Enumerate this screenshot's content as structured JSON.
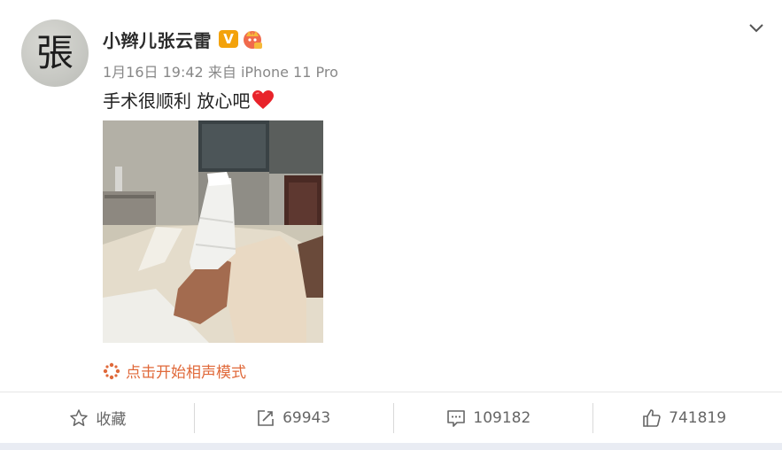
{
  "post": {
    "author": "小辫儿张云雷",
    "vip_mark": "V",
    "time": "1月16日 19:42",
    "source_prefix": "来自",
    "source": "iPhone 11 Pro",
    "text": "手术很顺利 放心吧",
    "avatar_char": "張"
  },
  "link": {
    "label": "点击开始相声模式"
  },
  "actions": {
    "favorite_label": "收藏",
    "repost_count": "69943",
    "comment_count": "109182",
    "like_count": "741819"
  },
  "colors": {
    "accent": "#e0693a",
    "vip": "#f3a20b",
    "heart": "#e8232a",
    "muted": "#888888"
  },
  "icons": [
    "chevron-down-icon",
    "vip-icon",
    "level-badge-icon",
    "heart-icon",
    "sparkle-icon",
    "star-icon",
    "repost-icon",
    "comment-icon",
    "like-icon"
  ]
}
